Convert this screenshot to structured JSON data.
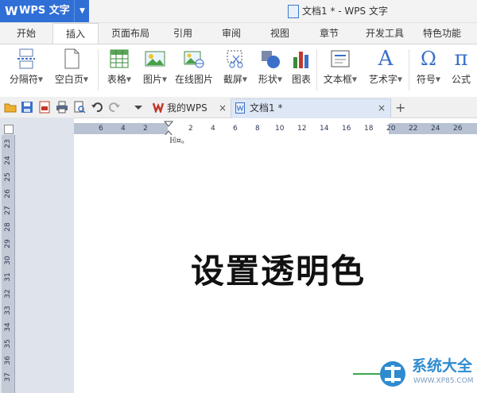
{
  "app": {
    "logo": "W",
    "name": "WPS 文字",
    "dropdown": "▼",
    "window_title": "文档1 * - WPS 文字"
  },
  "ribbon_tabs": [
    {
      "label": "开始"
    },
    {
      "label": "插入"
    },
    {
      "label": "页面布局"
    },
    {
      "label": "引用"
    },
    {
      "label": "审阅"
    },
    {
      "label": "视图"
    },
    {
      "label": "章节"
    },
    {
      "label": "开发工具"
    },
    {
      "label": "特色功能"
    }
  ],
  "active_tab": "插入",
  "ribbon_buttons": [
    {
      "label": "分隔符",
      "icon": "page-break-icon"
    },
    {
      "label": "空白页",
      "icon": "blank-page-icon"
    },
    {
      "label": "表格",
      "icon": "table-icon"
    },
    {
      "label": "图片",
      "icon": "picture-icon"
    },
    {
      "label": "在线图片",
      "icon": "online-picture-icon"
    },
    {
      "label": "截屏",
      "icon": "screenshot-icon"
    },
    {
      "label": "形状",
      "icon": "shapes-icon"
    },
    {
      "label": "图表",
      "icon": "chart-icon"
    },
    {
      "label": "文本框",
      "icon": "textbox-icon"
    },
    {
      "label": "艺术字",
      "icon": "wordart-icon"
    },
    {
      "label": "符号",
      "icon": "symbol-icon"
    },
    {
      "label": "公式",
      "icon": "formula-icon"
    }
  ],
  "icon_glyphs": {
    "wordart": "A",
    "symbol": "Ω",
    "formula": "π"
  },
  "doc_tabs": [
    {
      "label": "我的WPS",
      "close": "×"
    },
    {
      "label": "文档1 *",
      "close": "×"
    }
  ],
  "new_tab_symbol": "+",
  "ruler_h": [
    "6",
    "4",
    "2",
    "2",
    "4",
    "6",
    "8",
    "10",
    "12",
    "14",
    "16",
    "18",
    "20",
    "22",
    "24",
    "26"
  ],
  "ruler_v": [
    "23",
    "24",
    "25",
    "26",
    "27",
    "28",
    "29",
    "30",
    "31",
    "32",
    "33",
    "34",
    "35",
    "36",
    "37"
  ],
  "document": {
    "text": "设置透明色",
    "cursor_text": "ℍ¤。"
  },
  "watermark": {
    "text": "系统大全",
    "url": "WWW.XP85.COM"
  },
  "colors": {
    "brand": "#2f6fd6",
    "accent": "#2e8bd0"
  }
}
